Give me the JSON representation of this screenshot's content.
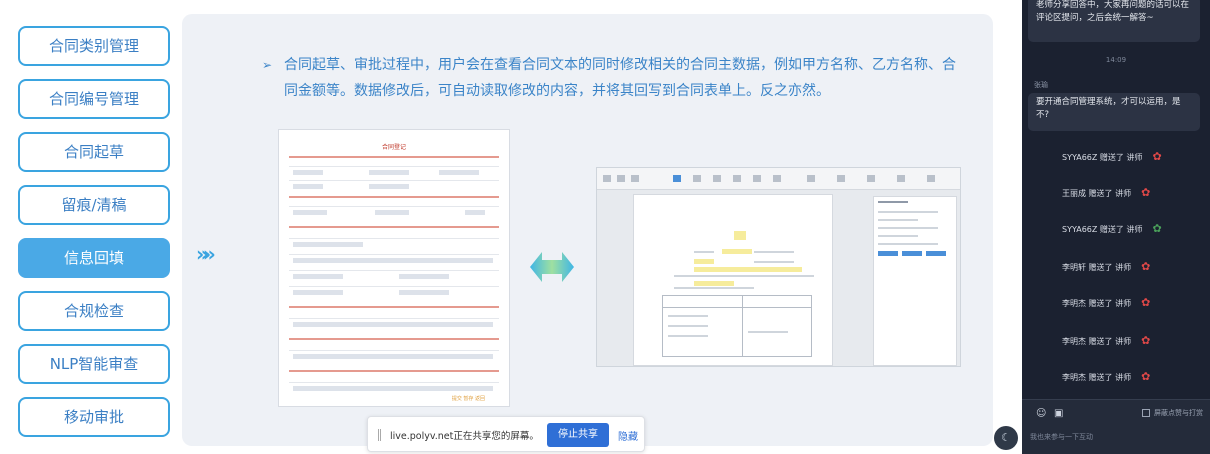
{
  "menu": {
    "items": [
      {
        "label": "合同类别管理",
        "active": false
      },
      {
        "label": "合同编号管理",
        "active": false
      },
      {
        "label": "合同起草",
        "active": false
      },
      {
        "label": "留痕/清稿",
        "active": false
      },
      {
        "label": "信息回填",
        "active": true
      },
      {
        "label": "合规检查",
        "active": false
      },
      {
        "label": "NLP智能审查",
        "active": false
      },
      {
        "label": "移动审批",
        "active": false
      }
    ]
  },
  "slide": {
    "bullet_marker": "➢",
    "bullet_text": "合同起草、审批过程中，用户会在查看合同文本的同时修改相关的合同主数据，例如甲方名称、乙方名称、合同金额等。数据修改后，可自动读取修改的内容，并将其回写到合同表单上。反之亦然。",
    "chevrons": "»»",
    "form_title": "合同登记",
    "form_footer": "提交 暂存 返回"
  },
  "share_bar": {
    "message": "live.polyv.net正在共享您的屏幕。",
    "stop_label": "停止共享",
    "hide_label": "隐藏"
  },
  "chat": {
    "bubble_top": "老师分享回答中，大家再问题的话可以在评论区提问，之后会统一解答~",
    "timestamp": "14:09",
    "nickname": "张瑜",
    "bubble_question": "要开通合同管理系统，才可以运用，是不?",
    "gifts": [
      {
        "text": "SYYA66Z 赠送了 讲师"
      },
      {
        "text": "王丽成 赠送了 讲师"
      },
      {
        "text": "SYYA66Z 赠送了 讲师"
      },
      {
        "text": "李明轩 赠送了 讲师"
      },
      {
        "text": "李明杰 赠送了 讲师"
      },
      {
        "text": "李明杰 赠送了 讲师"
      },
      {
        "text": "李明杰 赠送了 讲师"
      }
    ],
    "only_teacher_label": "屏蔽点赞与打赏",
    "input_placeholder": "我也来参与一下互动"
  },
  "colors": {
    "accent": "#3aa4e0",
    "active_menu": "#4aa9e6",
    "chat_bg": "#1b2130",
    "stop_button": "#2f6fd6"
  }
}
